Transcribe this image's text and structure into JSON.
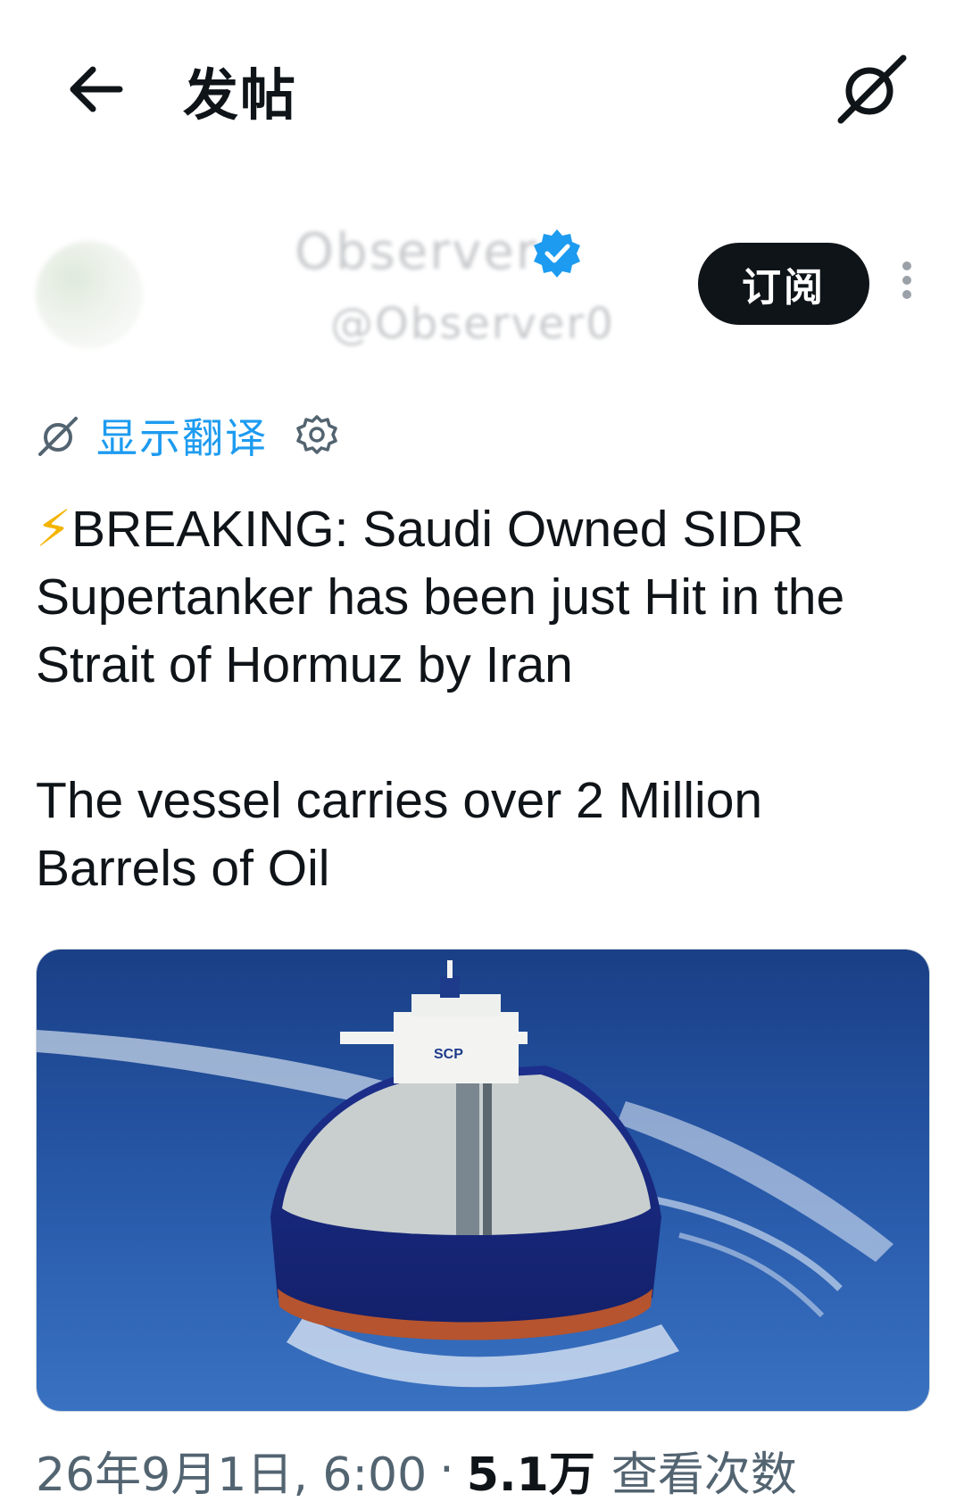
{
  "header": {
    "title": "发帖",
    "back_icon": "arrow-left-icon",
    "grok_icon": "grok-icon"
  },
  "author": {
    "display_name": "Observer",
    "handle": "@Observer0",
    "verified_icon": "verified-badge-icon",
    "verified_color": "#1d9bf0",
    "subscribe_label": "订阅",
    "more_icon": "more-vertical-icon"
  },
  "translate": {
    "link_label": "显示翻译",
    "icon": "grok-icon",
    "settings_icon": "gear-icon",
    "link_color": "#1d9bf0"
  },
  "post": {
    "line1": "⚡",
    "line1_text": "BREAKING: Saudi Owned SIDR Supertanker has been just Hit in the Strait of Hormuz by Iran",
    "line2_text": "The vessel carries over 2 Million Barrels of Oil"
  },
  "media": {
    "description": "",
    "ship_label": "SCP"
  },
  "meta": {
    "timestamp": "26年9月1日, 6:00",
    "separator": "·",
    "views_count": "5.1万",
    "views_label": "查看次数"
  }
}
